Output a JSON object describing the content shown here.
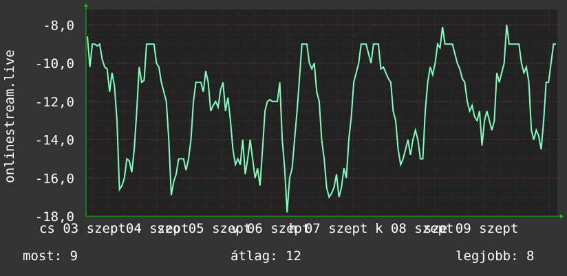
{
  "chart_data": {
    "type": "line",
    "ylabel": "onlinestream.live",
    "ylim": [
      -18.0,
      -7.2
    ],
    "y_ticks": [
      -18,
      -16,
      -14,
      -12,
      -10,
      -8
    ],
    "y_tick_labels": [
      "-18,0",
      "-16,0",
      "-14,0",
      "-12,0",
      "-10,0",
      "-8,0"
    ],
    "x_labels": [
      "cs 03 szept",
      "p 04 szept",
      "szo 05 szept",
      "v 06 szept",
      "h 07 szept",
      "k 08 szept",
      "sze 09 szept"
    ],
    "grid": true,
    "colors": {
      "line": "#7fffbf",
      "background": "#333333",
      "plot_background": "#222222",
      "grid": "#5a3a3a",
      "axis": "#00cc00",
      "text": "#ffffff"
    },
    "series": [
      {
        "x": [
          0,
          0.15,
          0.3,
          0.45,
          0.6,
          0.8,
          1.0,
          1.05,
          1.1,
          1.15,
          1.2,
          1.25,
          1.3,
          1.35,
          1.4,
          1.5,
          1.6,
          1.7,
          1.8,
          1.9,
          2.0,
          2.2,
          2.4,
          2.5,
          2.6,
          2.7,
          2.8,
          2.9,
          3.0,
          3.1,
          3.2,
          3.3,
          3.4,
          3.5,
          3.6,
          3.65,
          3.7,
          3.75,
          3.8,
          3.85,
          3.9,
          3.95,
          4.0,
          4.1,
          4.2,
          4.3,
          4.4,
          4.5,
          4.55,
          4.6,
          4.65,
          4.7,
          4.75,
          4.8,
          4.85,
          4.9,
          5.0,
          5.05,
          5.1,
          5.2,
          5.3,
          5.4,
          5.5,
          5.6,
          5.65,
          5.7,
          5.75,
          5.8,
          5.85,
          5.9,
          5.95,
          6.0,
          6.1,
          6.2,
          6.3,
          6.4,
          6.45,
          6.5,
          6.55,
          6.6,
          6.65,
          6.7,
          6.75,
          6.8,
          6.85,
          6.9,
          6.95,
          7.0
        ],
        "y": [
          -8.7,
          -10.0,
          -9.0,
          -9.0,
          -9.0,
          -10.0,
          -10.3,
          -11.5,
          -10.5,
          -11.2,
          -13.0,
          -16.5,
          -16.3,
          -16.0,
          -15.0,
          -15.2,
          -15.7,
          -14.5,
          -12.5,
          -10.2,
          -10.9,
          -9.0,
          -9.0,
          -10.0,
          -9.0,
          -9.0,
          -10.0,
          -10.2,
          -11.5,
          -14.0,
          -16.9,
          -16.2,
          -15.0,
          -15.0,
          -15.6,
          -15.0,
          -12.0,
          -11.0,
          -11.0,
          -11.5,
          -10.4,
          -11.0,
          -12.5,
          -12.0,
          -12.3,
          -11.0,
          -12.5,
          -13.0,
          -14.5,
          -15.3,
          -15.0,
          -15.0,
          -14.0,
          -15.8,
          -15.0,
          -14.0,
          -16.0,
          -15.5,
          -16.4,
          -14.5,
          -12.5,
          -11.9,
          -12.0,
          -12.0,
          -11.0,
          -14.0,
          -15.5,
          -17.8,
          -16.0,
          -14.0,
          -12.5,
          -10.8,
          -14.0,
          -16.5,
          -17.0,
          -16.8,
          -16.5,
          -15.8,
          -17.0,
          -16.5,
          -15.5,
          -12.8,
          -11.0,
          -10.0,
          -9.0,
          -9.5,
          -9.0,
          -9.0
        ]
      }
    ],
    "segments": [
      {
        "x": [
          0,
          0.99
        ],
        "y": [
          -8.6,
          -10.2,
          -9.0,
          -9.0,
          -9.1,
          -9.0,
          -9.8,
          -10.2,
          -10.3,
          -11.5,
          -10.5,
          -11.2,
          -13.0,
          -16.6,
          -16.4,
          -16.0,
          -15.0,
          -15.1,
          -15.7,
          -14.5,
          -12.5,
          -10.2,
          -11.0,
          -10.9,
          -9.0,
          -9.0,
          -9.0,
          -9.0,
          -10.0,
          -10.2,
          -11.0,
          -11.5,
          -12.0,
          -14.0,
          -16.9,
          -16.2,
          -15.8,
          -15.0,
          -15.0,
          -15.0,
          -15.6,
          -15.0,
          -14.0,
          -12.0,
          -11.0,
          -11.0,
          -11.0,
          -11.5,
          -10.4,
          -11.0,
          -12.5,
          -12.2,
          -12.0,
          -12.3,
          -11.4,
          -11.0,
          -12.5,
          -11.8,
          -13.0,
          -14.5,
          -15.3,
          -15.0,
          -15.3,
          -14.0,
          -15.8,
          -15.0,
          -14.0,
          -15.0,
          -16.0,
          -15.5,
          -16.4,
          -14.5,
          -12.5,
          -12.0,
          -11.9,
          -12.0,
          -12.0,
          -12.0,
          -11.0,
          -14.0,
          -15.5,
          -17.8,
          -16.0,
          -15.5,
          -14.0,
          -12.5,
          -10.8,
          -9.0,
          -9.0,
          -9.0,
          -10.0,
          -10.3,
          -10.0,
          -11.5,
          -12.0,
          -14.0,
          -15.0,
          -16.5,
          -17.0,
          -16.8,
          -16.5,
          -15.8,
          -17.0,
          -16.5,
          -15.5,
          -16.0,
          -14.0,
          -12.8,
          -11.0,
          -10.5,
          -10.0,
          -9.0,
          -9.0,
          -9.0,
          -9.5,
          -10.0,
          -9.0,
          -9.0,
          -9.0,
          -10.3,
          -10.2,
          -10.5,
          -10.8,
          -11.0,
          -12.5,
          -13.0,
          -14.5,
          -15.3,
          -15.0,
          -14.5,
          -14.0,
          -14.8,
          -14.0,
          -13.5,
          -14.0,
          -15.0,
          -15.0,
          -12.5,
          -11.0,
          -10.2,
          -10.6,
          -10.0,
          -9.0,
          -9.2,
          -8.1,
          -9.0,
          -9.0,
          -9.0,
          -9.0,
          -9.5,
          -10.0,
          -10.3,
          -10.8,
          -11.0,
          -12.0,
          -12.5,
          -12.2,
          -12.8,
          -13.0,
          -12.5,
          -14.3,
          -13.0,
          -12.5,
          -13.0,
          -13.5,
          -13.0,
          -10.5,
          -11.0,
          -10.5,
          -10.0,
          -8.0,
          -9.0,
          -9.0,
          -9.0,
          -9.0,
          -9.0,
          -10.0,
          -10.5,
          -10.2,
          -11.0,
          -13.5,
          -14.0,
          -13.5,
          -13.8,
          -14.5,
          -13.0,
          -11.0,
          -11.0,
          -10.0,
          -9.0,
          -9.0
        ]
      }
    ]
  },
  "stats": {
    "current": "most: 9",
    "average": "átlag: 12",
    "best": "legjobb: 8"
  }
}
